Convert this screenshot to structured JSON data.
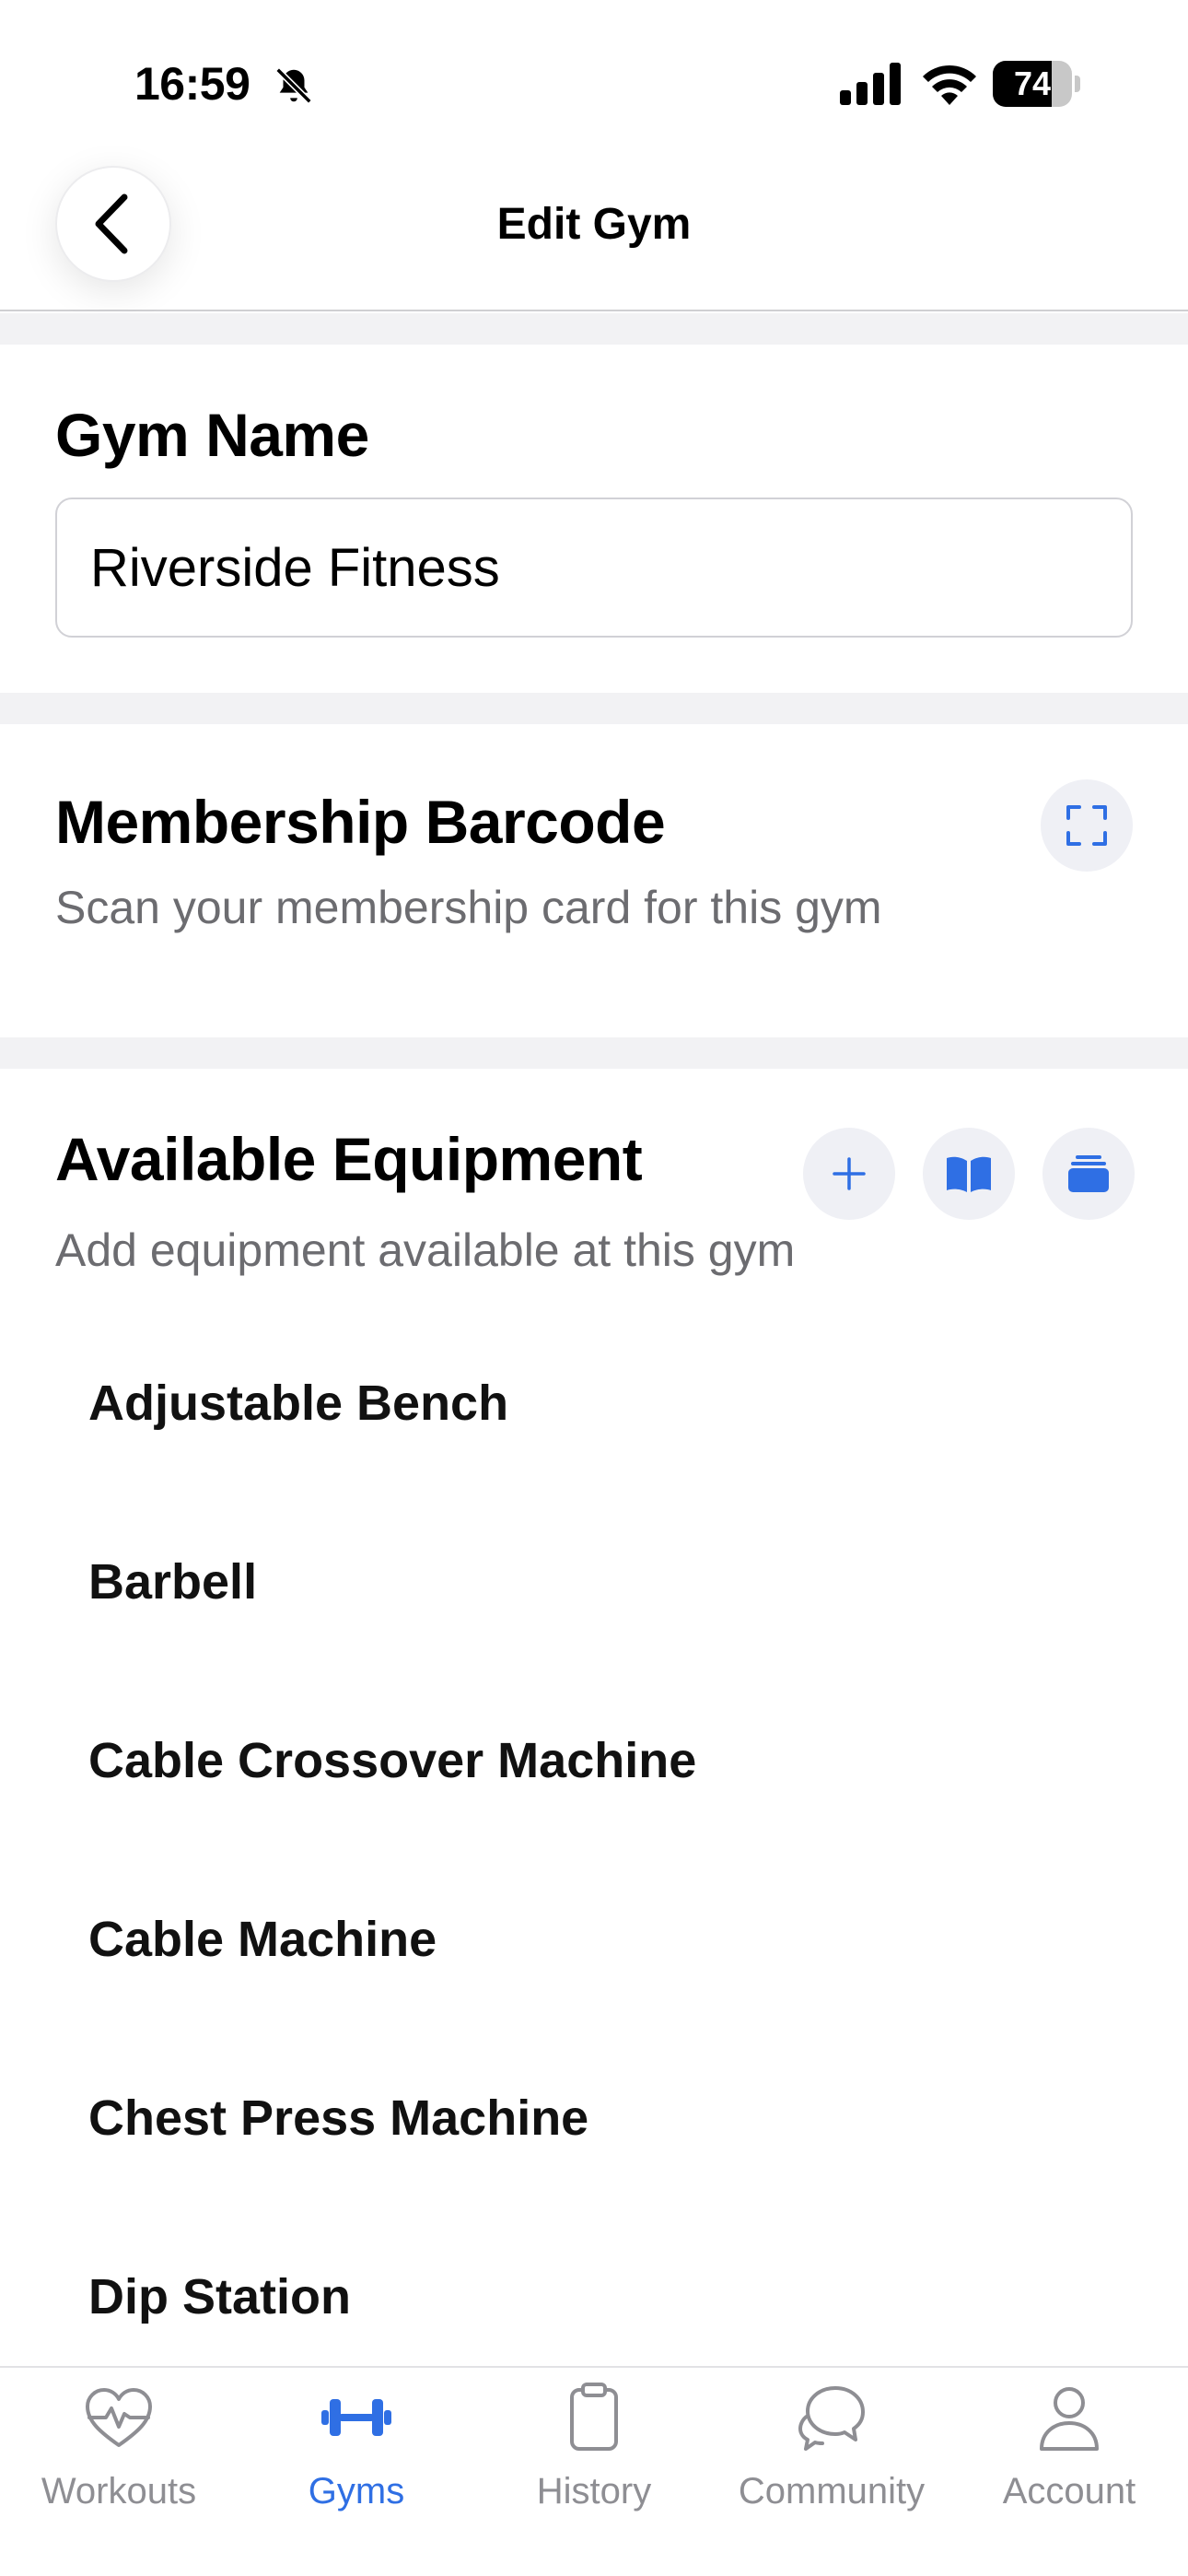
{
  "status_bar": {
    "time": "16:59",
    "battery": "74",
    "battery_level": 0.74
  },
  "nav": {
    "title": "Edit Gym"
  },
  "gym_name": {
    "label": "Gym Name",
    "value": "Riverside Fitness"
  },
  "barcode": {
    "title": "Membership Barcode",
    "subtitle": "Scan your membership card for this gym"
  },
  "equipment": {
    "title": "Available Equipment",
    "subtitle": "Add equipment available at this gym",
    "items": [
      "Adjustable Bench",
      "Barbell",
      "Cable Crossover Machine",
      "Cable Machine",
      "Chest Press Machine",
      "Dip Station"
    ]
  },
  "tabs": [
    {
      "label": "Workouts",
      "icon": "heart-pulse-icon",
      "active": false
    },
    {
      "label": "Gyms",
      "icon": "dumbbell-icon",
      "active": true
    },
    {
      "label": "History",
      "icon": "clipboard-icon",
      "active": false
    },
    {
      "label": "Community",
      "icon": "chat-bubbles-icon",
      "active": false
    },
    {
      "label": "Account",
      "icon": "person-icon",
      "active": false
    }
  ],
  "colors": {
    "accent": "#2f6fe4",
    "inactive": "#8e8e93",
    "section_gap": "#f2f2f4"
  }
}
